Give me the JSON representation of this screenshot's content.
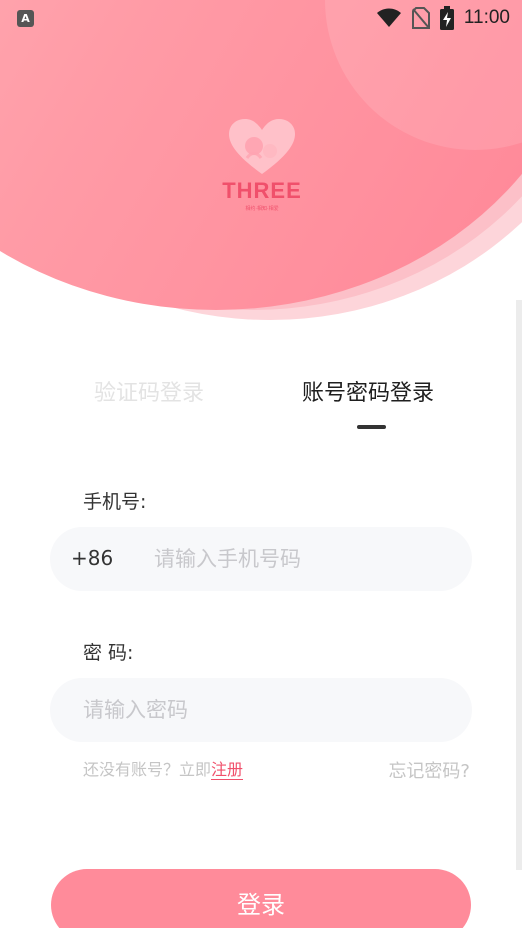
{
  "status_bar": {
    "app_icon_letter": "A",
    "time": "11:00",
    "icons": [
      "wifi-icon",
      "no-sim-icon",
      "battery-charging-icon"
    ]
  },
  "logo": {
    "wordmark": "THREE",
    "tagline": "相约·相知·相爱"
  },
  "tabs": [
    {
      "label": "验证码登录",
      "active": false
    },
    {
      "label": "账号密码登录",
      "active": true
    }
  ],
  "form": {
    "phone_label": "手机号:",
    "country_code": "+86",
    "phone_placeholder": "请输入手机号码",
    "password_label": "密 码:",
    "password_placeholder": "请输入密码",
    "register_prompt": "还没有账号？立即",
    "register_link": "注册",
    "forgot_password": "忘记密码?"
  },
  "login_button": "登录",
  "colors": {
    "accent": "#f0506b",
    "button": "#ff8b9a",
    "hero_gradient_start": "#ffb3b9",
    "hero_gradient_end": "#ff8596"
  }
}
